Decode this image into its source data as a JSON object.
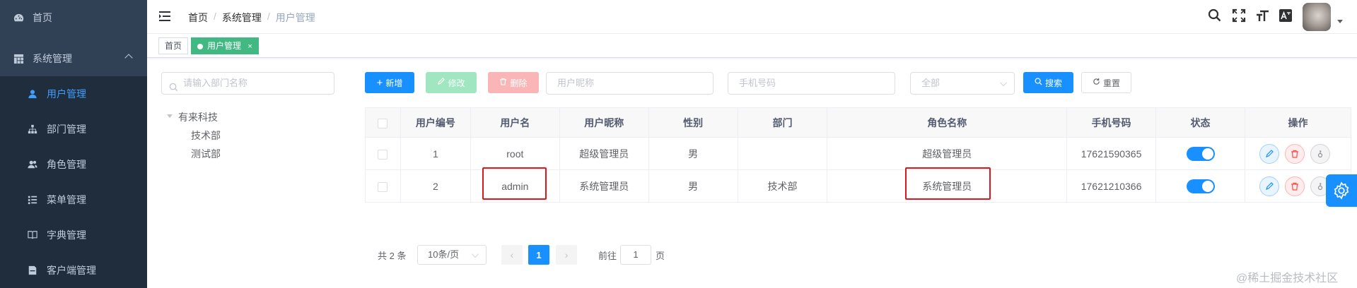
{
  "sidebar": {
    "items": [
      {
        "label": "首页",
        "icon": "dashboard-icon"
      },
      {
        "label": "系统管理",
        "icon": "system-icon"
      },
      {
        "label": "用户管理",
        "icon": "user-icon"
      },
      {
        "label": "部门管理",
        "icon": "tree-icon"
      },
      {
        "label": "角色管理",
        "icon": "peoples-icon"
      },
      {
        "label": "菜单管理",
        "icon": "menu-icon"
      },
      {
        "label": "字典管理",
        "icon": "book-icon"
      },
      {
        "label": "客户端管理",
        "icon": "client-icon"
      }
    ]
  },
  "breadcrumb": {
    "home": "首页",
    "sep": "/",
    "system": "系统管理",
    "current": "用户管理"
  },
  "tags": {
    "home": "首页",
    "active": "用户管理",
    "close": "×"
  },
  "toolbar": {
    "dept_search_placeholder": "请输入部门名称",
    "add": "新增",
    "edit": "修改",
    "delete": "删除",
    "nickname_placeholder": "用户昵称",
    "phone_placeholder": "手机号码",
    "status_select": "全部",
    "search": "搜索",
    "reset": "重置"
  },
  "tree": {
    "root": "有来科技",
    "children": [
      "技术部",
      "测试部"
    ]
  },
  "table": {
    "headers": [
      "用户编号",
      "用户名",
      "用户昵称",
      "性别",
      "部门",
      "角色名称",
      "手机号码",
      "状态",
      "操作"
    ],
    "rows": [
      {
        "id": "1",
        "username": "root",
        "nickname": "超级管理员",
        "gender": "男",
        "dept": "",
        "role": "超级管理员",
        "phone": "17621590365"
      },
      {
        "id": "2",
        "username": "admin",
        "nickname": "系统管理员",
        "gender": "男",
        "dept": "技术部",
        "role": "系统管理员",
        "phone": "17621210366"
      }
    ]
  },
  "pagination": {
    "total": "共 2 条",
    "page_size": "10条/页",
    "page": "1",
    "goto_label": "前往",
    "goto_value": "1",
    "page_unit": "页"
  },
  "watermark": "@稀土掘金技术社区",
  "colors": {
    "sidebar_bg": "#304156",
    "primary": "#1890ff",
    "tag_active": "#42b983",
    "highlight": "#e0161d"
  }
}
